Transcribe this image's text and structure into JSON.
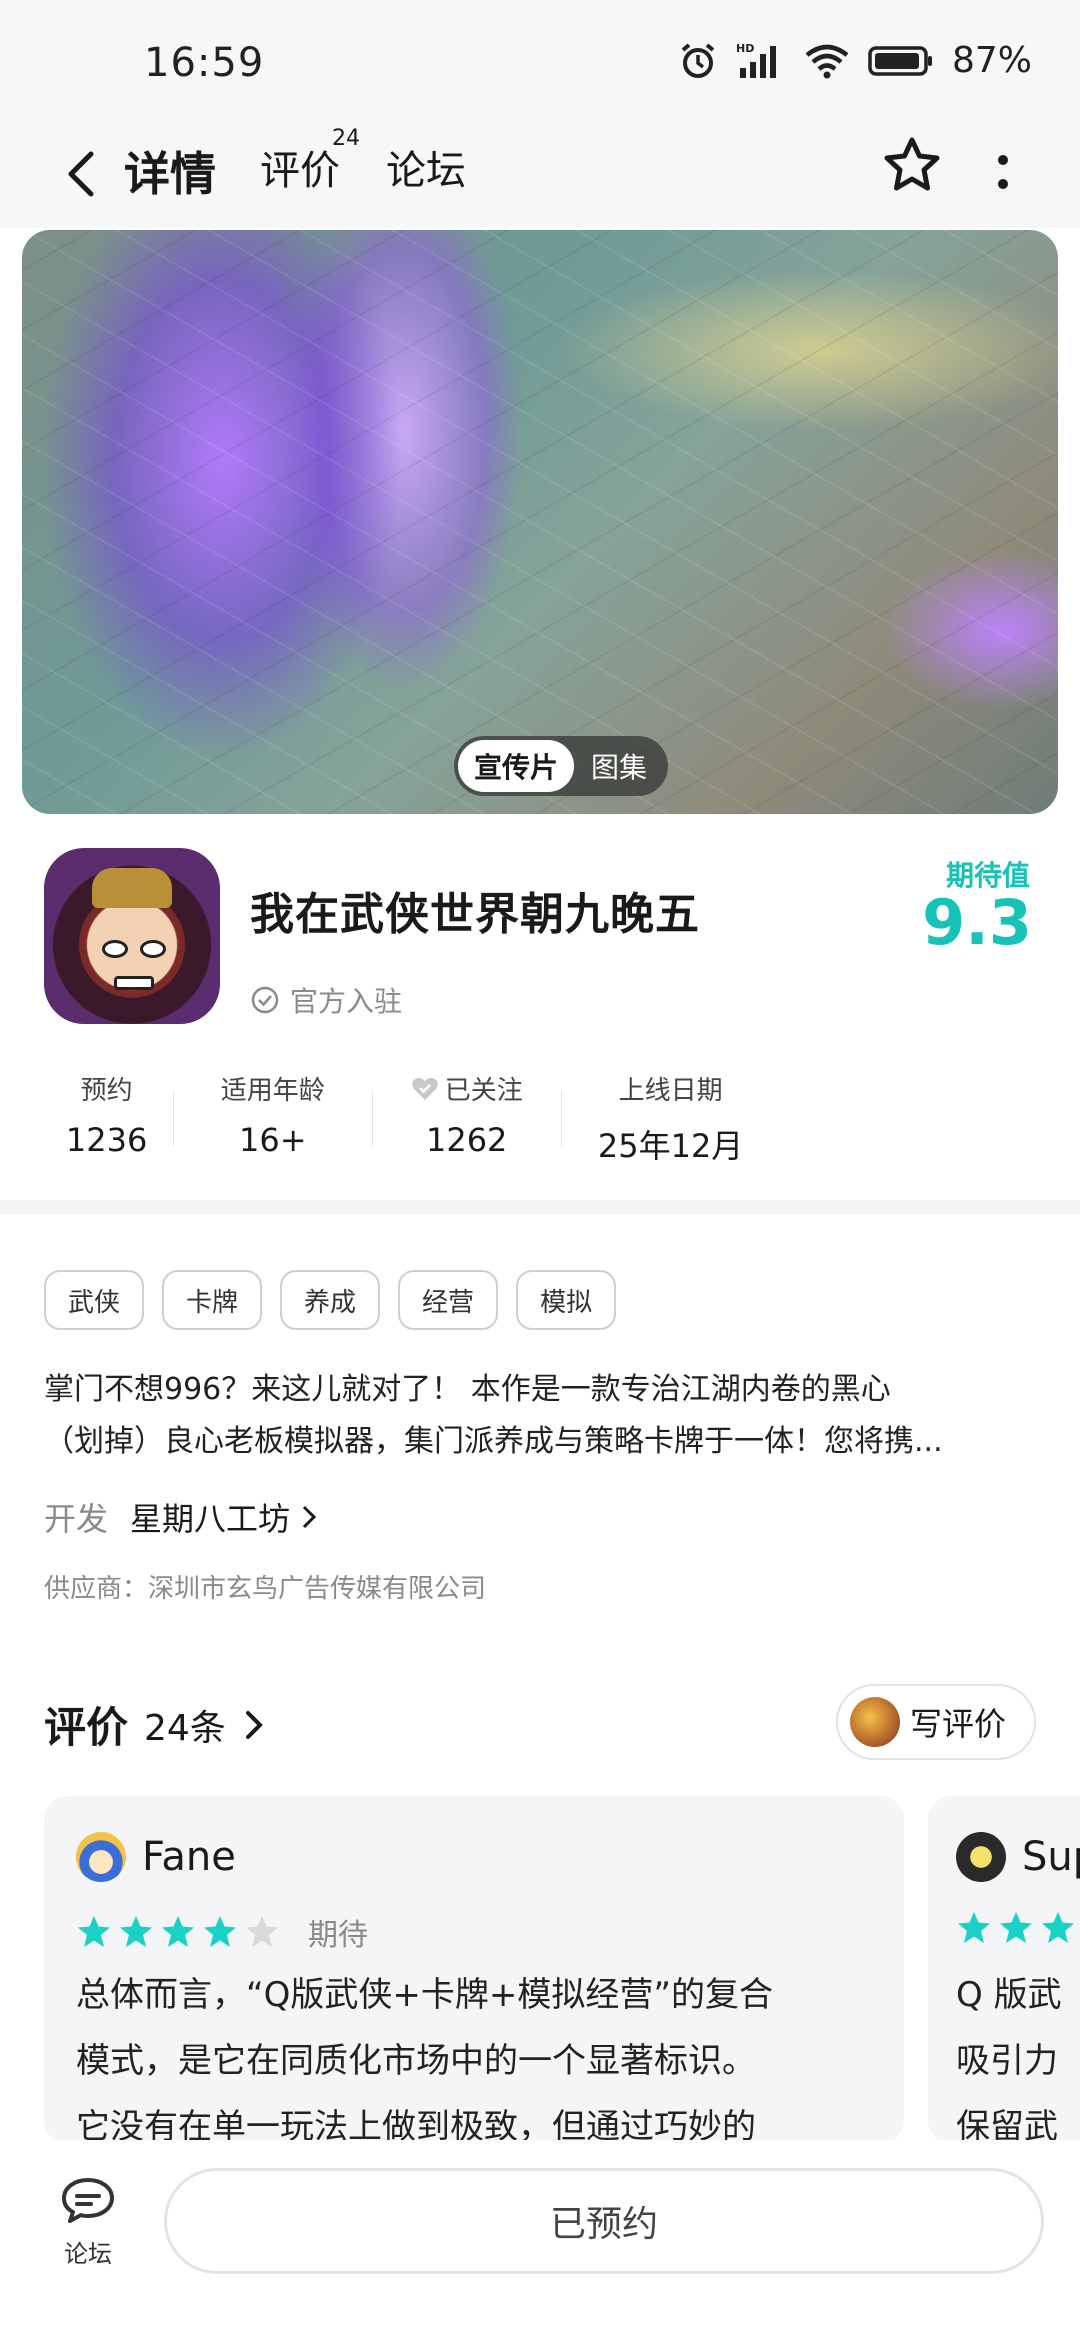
{
  "status_bar": {
    "time": "16:59",
    "battery": "87%"
  },
  "header": {
    "tabs": [
      {
        "label": "详情",
        "active": true
      },
      {
        "label": "评价",
        "badge": "24"
      },
      {
        "label": "论坛"
      }
    ]
  },
  "banner": {
    "switch": [
      "宣传片",
      "图集"
    ]
  },
  "app": {
    "title": "我在武侠世界朝九晚五",
    "official_label": "官方入驻",
    "rating_label": "期待值",
    "rating_value": "9.3"
  },
  "stats": [
    {
      "label": "预约",
      "value": "1236"
    },
    {
      "label": "适用年龄",
      "value": "16+"
    },
    {
      "label": "已关注",
      "value": "1262"
    },
    {
      "label": "上线日期",
      "value": "25年12月"
    }
  ],
  "tags": [
    "武侠",
    "卡牌",
    "养成",
    "经营",
    "模拟"
  ],
  "description": {
    "line1": "掌门不想996？来这儿就对了！ 本作是一款专治江湖内卷的黑心",
    "line2": "（划掉）良心老板模拟器，集门派养成与策略卡牌于一体！您将携..."
  },
  "developer": {
    "label": "开发",
    "name": "星期八工坊"
  },
  "supplier": "供应商：深圳市玄鸟广告传媒有限公司",
  "reviews": {
    "title": "评价",
    "count": "24条",
    "write_button": "写评价",
    "items": [
      {
        "user": "Fane",
        "stars": 4,
        "status": "期待",
        "lines": [
          "总体而言，“Q版武侠+卡牌+模拟经营”的复合",
          "模式，是它在同质化市场中的一个显著标识。",
          "它没有在单一玩法上做到极致，但通过巧妙的"
        ]
      },
      {
        "user": "Sup",
        "stars": 3,
        "lines": [
          "Q 版武",
          "吸引力",
          "保留武"
        ]
      }
    ]
  },
  "bottom": {
    "forum_label": "论坛",
    "reserved_button": "已预约"
  },
  "colors": {
    "accent": "#19c2b6",
    "star_filled": "#19d1c4",
    "star_empty": "#d9d9d9"
  }
}
